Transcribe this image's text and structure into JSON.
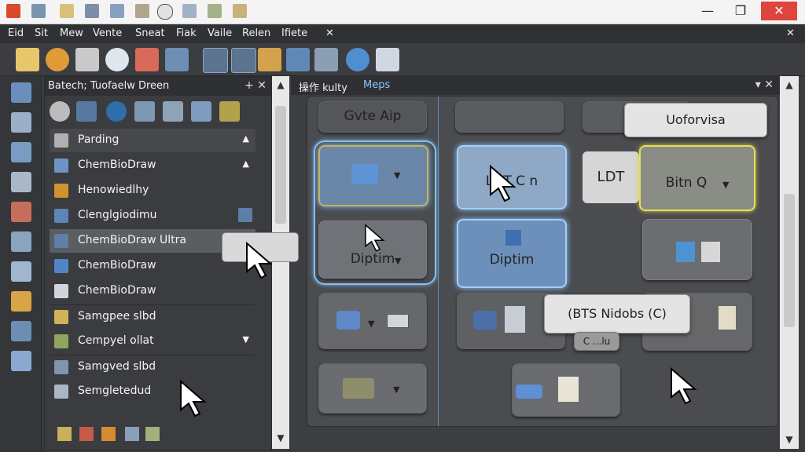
{
  "menu": [
    "Eid",
    "Sit",
    "Mew",
    "Vente",
    "Sneat",
    "Fiak",
    "Vaile",
    "Relen",
    "Ifiete"
  ],
  "menu_close": "✕",
  "window": {
    "minimize": "—",
    "maximize": "❐",
    "close": "✕"
  },
  "left_panel": {
    "title": "Batech;  Tuofaelw Dreen",
    "pin": "+",
    "close": "✕",
    "rows": [
      {
        "label": "Parding",
        "icon": "category-icon",
        "type": "header"
      },
      {
        "label": "ChemBioDraw",
        "icon": "drawing-icon",
        "type": "item"
      },
      {
        "label": "Henowiedlhy",
        "icon": "pen-icon",
        "type": "item"
      },
      {
        "label": "Clenglgiodimu",
        "icon": "molecule-icon",
        "type": "item"
      },
      {
        "label": "ChemBioDraw Ultra",
        "icon": "document-icon",
        "type": "selected"
      },
      {
        "label": "ChemBioDraw",
        "icon": "flask-icon",
        "type": "item"
      },
      {
        "label": "ChemBioDraw",
        "icon": "page-icon",
        "type": "item"
      },
      {
        "label": "Samgpee slbd",
        "icon": "star-icon",
        "type": "item"
      },
      {
        "label": "Cempyel ollat",
        "icon": "arrow-icon",
        "type": "item"
      },
      {
        "label": "Samgved slbd",
        "icon": "grid-icon",
        "type": "item"
      },
      {
        "label": "Semgletedud",
        "icon": "list-icon",
        "type": "item"
      }
    ]
  },
  "main_panel": {
    "title": "操作 kulty",
    "title_link": "Meps",
    "pin": "▾",
    "close": "✕",
    "cards": {
      "top_left": "Gvte Aip",
      "highlight_left_bottom": "Diptim",
      "center_top": "LDT C n",
      "center_mid": "Diptim",
      "right_top": "Bitn Q",
      "right_floating": "LDT"
    },
    "tooltips": {
      "top_right": "Uoforvisa",
      "center": "(BTS Nidobs (C)",
      "partial": "C ...lu"
    }
  },
  "colors": {
    "accent_blue": "#9fd0ff",
    "accent_yellow": "#e6df56",
    "panel_bg": "#3a3c3f"
  }
}
